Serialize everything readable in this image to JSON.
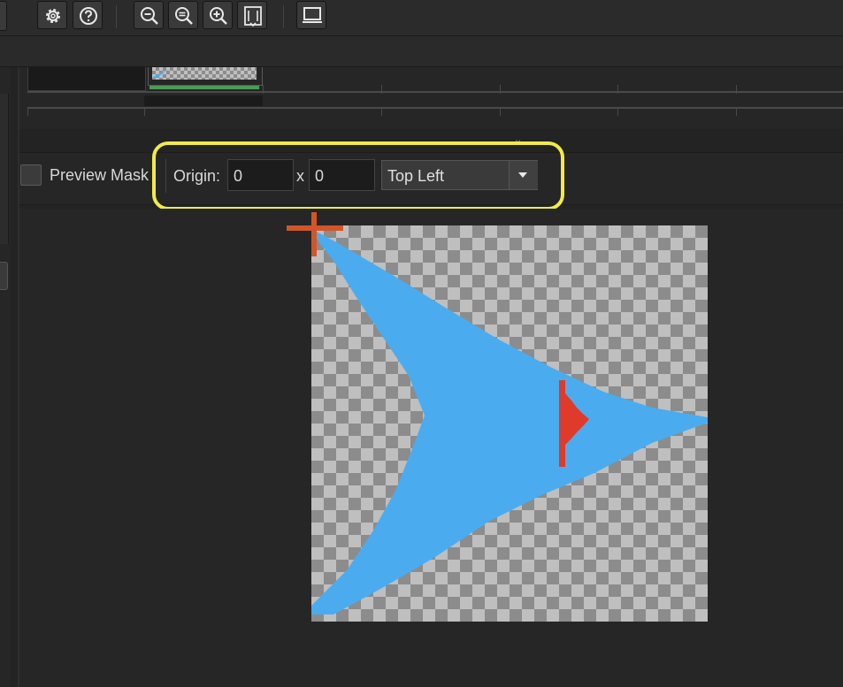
{
  "toolbar": {
    "buttons": [
      {
        "name": "settings",
        "icon": "gear-icon"
      },
      {
        "name": "help",
        "icon": "help-icon"
      },
      {
        "name": "zoom-out",
        "icon": "zoom-out-icon"
      },
      {
        "name": "zoom-reset",
        "icon": "zoom-reset-icon"
      },
      {
        "name": "zoom-in",
        "icon": "zoom-in-icon"
      },
      {
        "name": "zoom-fit",
        "icon": "zoom-fit-icon"
      },
      {
        "name": "display",
        "icon": "monitor-icon"
      }
    ]
  },
  "origin_row": {
    "preview_mask_label": "Preview Mask",
    "preview_mask_checked": false,
    "origin_label": "Origin:",
    "origin_x": "0",
    "x_separator": "x",
    "origin_y": "0",
    "anchor_selected": "Top Left",
    "close_glyph": "×"
  },
  "canvas": {
    "sprite_description_colors": {
      "arrow": "#4aacef",
      "marker": "#e03a2a",
      "origin_cross": "#d2552a"
    },
    "highlight_color": "#f1ea4a"
  }
}
